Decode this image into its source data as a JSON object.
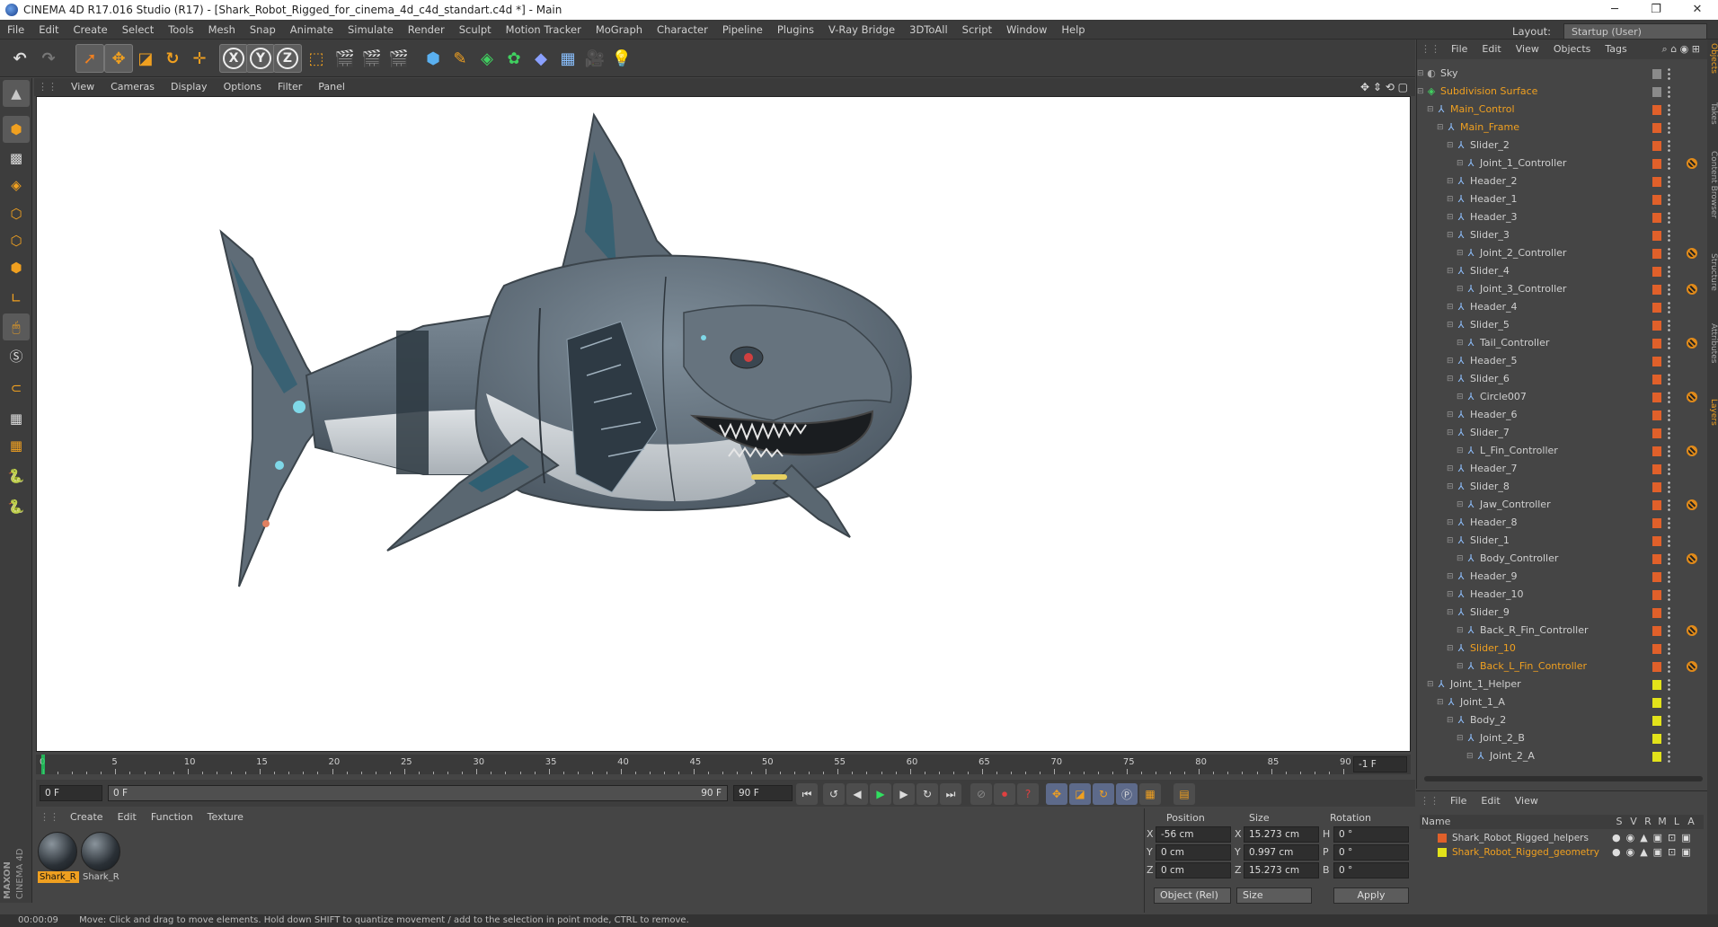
{
  "window": {
    "title": "CINEMA 4D R17.016 Studio (R17) - [Shark_Robot_Rigged_for_cinema_4d_c4d_standart.c4d *] - Main",
    "minimize": "─",
    "restore": "❐",
    "close": "✕"
  },
  "menubar": {
    "items": [
      "File",
      "Edit",
      "Create",
      "Select",
      "Tools",
      "Mesh",
      "Snap",
      "Animate",
      "Simulate",
      "Render",
      "Sculpt",
      "Motion Tracker",
      "MoGraph",
      "Character",
      "Pipeline",
      "Plugins",
      "V-Ray Bridge",
      "3DToAll",
      "Script",
      "Window",
      "Help"
    ],
    "layout_label": "Layout:",
    "layout_value": "Startup (User)"
  },
  "toolbar": {
    "x_axis": "X",
    "y_axis": "Y",
    "z_axis": "Z"
  },
  "viewport": {
    "menu": [
      "View",
      "Cameras",
      "Display",
      "Options",
      "Filter",
      "Panel"
    ]
  },
  "timeline": {
    "ticks": [
      "0",
      "5",
      "10",
      "15",
      "20",
      "25",
      "30",
      "35",
      "40",
      "45",
      "50",
      "55",
      "60",
      "65",
      "70",
      "75",
      "80",
      "85",
      "90"
    ],
    "current_frame": "-1 F"
  },
  "transport": {
    "start_field": "0 F",
    "slider_start": "0 F",
    "slider_end": "90 F",
    "end_field": "90 F"
  },
  "material_manager": {
    "menu": [
      "Create",
      "Edit",
      "Function",
      "Texture"
    ],
    "materials": [
      {
        "name": "Shark_R",
        "selected": true
      },
      {
        "name": "Shark_R",
        "selected": false
      }
    ]
  },
  "coordinates": {
    "headers": {
      "position": "Position",
      "size": "Size",
      "rotation": "Rotation"
    },
    "rows": [
      {
        "axis": "X",
        "pos": "-56 cm",
        "size_axis": "X",
        "size": "15.273 cm",
        "rot_axis": "H",
        "rot": "0 °"
      },
      {
        "axis": "Y",
        "pos": "0 cm",
        "size_axis": "Y",
        "size": "0.997 cm",
        "rot_axis": "P",
        "rot": "0 °"
      },
      {
        "axis": "Z",
        "pos": "0 cm",
        "size_axis": "Z",
        "size": "15.273 cm",
        "rot_axis": "B",
        "rot": "0 °"
      }
    ],
    "mode_dropdown": "Object (Rel)",
    "size_dropdown": "Size",
    "apply": "Apply"
  },
  "status": {
    "time": "00:00:09",
    "message": "Move: Click and drag to move elements. Hold down SHIFT to quantize movement / add to the selection in point mode, CTRL to remove."
  },
  "object_manager": {
    "menu": [
      "File",
      "Edit",
      "View",
      "Objects",
      "Tags"
    ],
    "objects": [
      {
        "name": "Sky",
        "indent": 0,
        "color": "#8a8a8a",
        "highlight": false,
        "tag": false
      },
      {
        "name": "Subdivision Surface",
        "indent": 0,
        "color": "#8a8a8a",
        "highlight": true,
        "tag": false
      },
      {
        "name": "Main_Control",
        "indent": 1,
        "color": "#e0602a",
        "highlight": true,
        "tag": false
      },
      {
        "name": "Main_Frame",
        "indent": 2,
        "color": "#e0602a",
        "highlight": true,
        "tag": false
      },
      {
        "name": "Slider_2",
        "indent": 3,
        "color": "#e0602a",
        "highlight": false,
        "tag": false
      },
      {
        "name": "Joint_1_Controller",
        "indent": 4,
        "color": "#e0602a",
        "highlight": false,
        "tag": true
      },
      {
        "name": "Header_2",
        "indent": 3,
        "color": "#e0602a",
        "highlight": false,
        "tag": false
      },
      {
        "name": "Header_1",
        "indent": 3,
        "color": "#e0602a",
        "highlight": false,
        "tag": false
      },
      {
        "name": "Header_3",
        "indent": 3,
        "color": "#e0602a",
        "highlight": false,
        "tag": false
      },
      {
        "name": "Slider_3",
        "indent": 3,
        "color": "#e0602a",
        "highlight": false,
        "tag": false
      },
      {
        "name": "Joint_2_Controller",
        "indent": 4,
        "color": "#e0602a",
        "highlight": false,
        "tag": true
      },
      {
        "name": "Slider_4",
        "indent": 3,
        "color": "#e0602a",
        "highlight": false,
        "tag": false
      },
      {
        "name": "Joint_3_Controller",
        "indent": 4,
        "color": "#e0602a",
        "highlight": false,
        "tag": true
      },
      {
        "name": "Header_4",
        "indent": 3,
        "color": "#e0602a",
        "highlight": false,
        "tag": false
      },
      {
        "name": "Slider_5",
        "indent": 3,
        "color": "#e0602a",
        "highlight": false,
        "tag": false
      },
      {
        "name": "Tail_Controller",
        "indent": 4,
        "color": "#e0602a",
        "highlight": false,
        "tag": true
      },
      {
        "name": "Header_5",
        "indent": 3,
        "color": "#e0602a",
        "highlight": false,
        "tag": false
      },
      {
        "name": "Slider_6",
        "indent": 3,
        "color": "#e0602a",
        "highlight": false,
        "tag": false
      },
      {
        "name": "Circle007",
        "indent": 4,
        "color": "#e0602a",
        "highlight": false,
        "tag": true
      },
      {
        "name": "Header_6",
        "indent": 3,
        "color": "#e0602a",
        "highlight": false,
        "tag": false
      },
      {
        "name": "Slider_7",
        "indent": 3,
        "color": "#e0602a",
        "highlight": false,
        "tag": false
      },
      {
        "name": "L_Fin_Controller",
        "indent": 4,
        "color": "#e0602a",
        "highlight": false,
        "tag": true
      },
      {
        "name": "Header_7",
        "indent": 3,
        "color": "#e0602a",
        "highlight": false,
        "tag": false
      },
      {
        "name": "Slider_8",
        "indent": 3,
        "color": "#e0602a",
        "highlight": false,
        "tag": false
      },
      {
        "name": "Jaw_Controller",
        "indent": 4,
        "color": "#e0602a",
        "highlight": false,
        "tag": true
      },
      {
        "name": "Header_8",
        "indent": 3,
        "color": "#e0602a",
        "highlight": false,
        "tag": false
      },
      {
        "name": "Slider_1",
        "indent": 3,
        "color": "#e0602a",
        "highlight": false,
        "tag": false
      },
      {
        "name": "Body_Controller",
        "indent": 4,
        "color": "#e0602a",
        "highlight": false,
        "tag": true
      },
      {
        "name": "Header_9",
        "indent": 3,
        "color": "#e0602a",
        "highlight": false,
        "tag": false
      },
      {
        "name": "Header_10",
        "indent": 3,
        "color": "#e0602a",
        "highlight": false,
        "tag": false
      },
      {
        "name": "Slider_9",
        "indent": 3,
        "color": "#e0602a",
        "highlight": false,
        "tag": false
      },
      {
        "name": "Back_R_Fin_Controller",
        "indent": 4,
        "color": "#e0602a",
        "highlight": false,
        "tag": true
      },
      {
        "name": "Slider_10",
        "indent": 3,
        "color": "#e0602a",
        "highlight": true,
        "tag": false
      },
      {
        "name": "Back_L_Fin_Controller",
        "indent": 4,
        "color": "#e0602a",
        "highlight": true,
        "tag": true
      },
      {
        "name": "Joint_1_Helper",
        "indent": 1,
        "color": "#e2e21a",
        "highlight": false,
        "tag": false
      },
      {
        "name": "Joint_1_A",
        "indent": 2,
        "color": "#e2e21a",
        "highlight": false,
        "tag": false
      },
      {
        "name": "Body_2",
        "indent": 3,
        "color": "#e2e21a",
        "highlight": false,
        "tag": false
      },
      {
        "name": "Joint_2_B",
        "indent": 4,
        "color": "#e2e21a",
        "highlight": false,
        "tag": false
      },
      {
        "name": "Joint_2_A",
        "indent": 5,
        "color": "#e2e21a",
        "highlight": false,
        "tag": false
      }
    ]
  },
  "layer_manager": {
    "menu": [
      "File",
      "Edit",
      "View"
    ],
    "name_header": "Name",
    "flags": [
      "S",
      "V",
      "R",
      "M",
      "L",
      "A"
    ],
    "layers": [
      {
        "name": "Shark_Robot_Rigged_helpers",
        "color": "#e0602a",
        "highlight": false
      },
      {
        "name": "Shark_Robot_Rigged_geometry",
        "color": "#e2e21a",
        "highlight": true
      }
    ]
  },
  "side_tabs": [
    "Objects",
    "Takes",
    "Content Browser",
    "Structure",
    "Attributes",
    "Layers"
  ],
  "brand": {
    "line1": "MAXON",
    "line2": "CINEMA 4D"
  },
  "colors": {
    "accent": "#f0a020",
    "selected_text": "#f0a020",
    "viewport_bg": "#ffffff"
  }
}
